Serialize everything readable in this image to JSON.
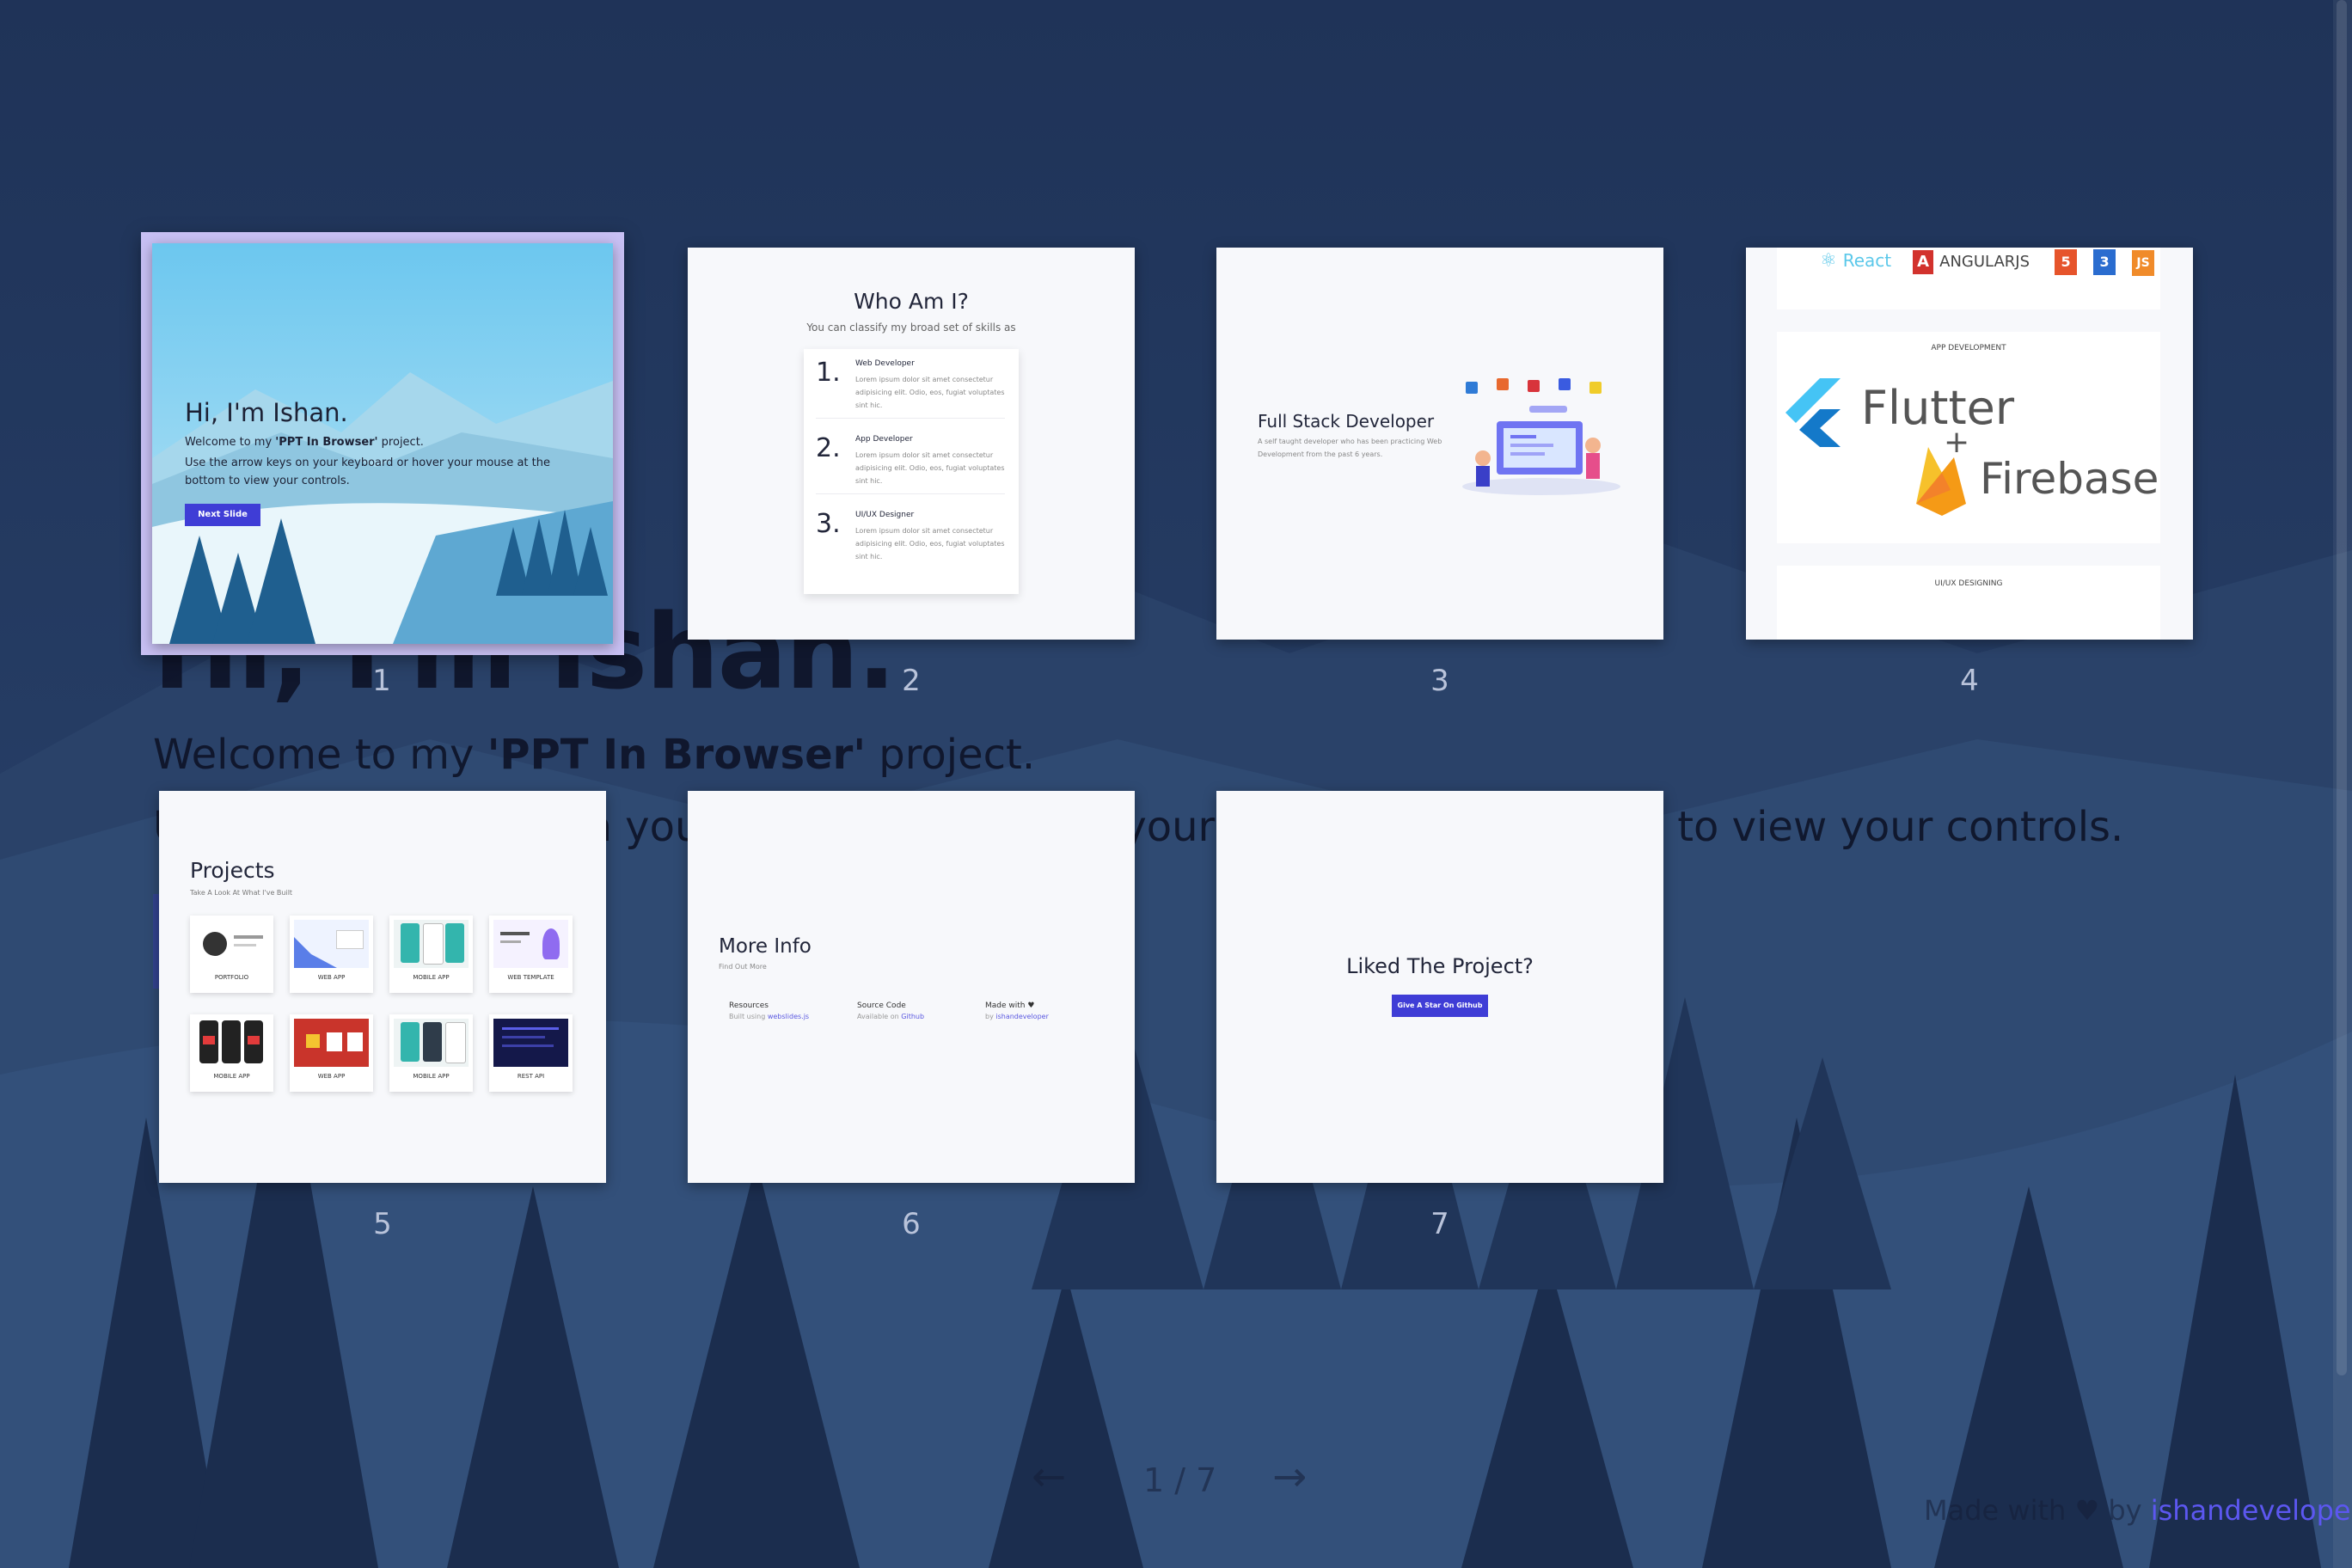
{
  "slides": [
    {
      "number": "1",
      "title": "Hi, I'm Ishan.",
      "welcome_prefix": "Welcome to my ",
      "project_name": "'PPT In Browser'",
      "welcome_suffix": " project.",
      "instructions": "Use the arrow keys on your keyboard or hover your mouse at the bottom to view your controls.",
      "button": "Next Slide"
    },
    {
      "number": "2",
      "title": "Who Am I?",
      "subtitle": "You can classify my broad set of skills as",
      "items": [
        {
          "num": "1.",
          "heading": "Web Developer",
          "text": "Lorem ipsum dolor sit amet consectetur adipisicing elit. Odio, eos, fugiat voluptates sint hic."
        },
        {
          "num": "2.",
          "heading": "App Developer",
          "text": "Lorem ipsum dolor sit amet consectetur adipisicing elit. Odio, eos, fugiat voluptates sint hic."
        },
        {
          "num": "3.",
          "heading": "UI/UX Designer",
          "text": "Lorem ipsum dolor sit amet consectetur adipisicing elit. Odio, eos, fugiat voluptates sint hic."
        }
      ]
    },
    {
      "number": "3",
      "title": "Full Stack Developer",
      "description": "A self taught developer who has been practicing Web Development from the past 6 years."
    },
    {
      "number": "4",
      "logos": [
        "React",
        "ANGULARJS",
        "5",
        "3",
        "JS"
      ],
      "app_label": "APP DEVELOPMENT",
      "flutter": "Flutter",
      "plus": "+",
      "firebase": "Firebase",
      "uiux_label": "UI/UX DESIGNING"
    },
    {
      "number": "5",
      "title": "Projects",
      "subtitle": "Take A Look At What I've Built",
      "tiles": [
        "PORTFOLIO",
        "WEB APP",
        "MOBILE APP",
        "WEB TEMPLATE",
        "MOBILE APP",
        "WEB APP",
        "MOBILE APP",
        "REST API"
      ]
    },
    {
      "number": "6",
      "title": "More Info",
      "subtitle": "Find Out More",
      "columns": [
        {
          "heading": "Resources",
          "text": "Built using ",
          "link": "webslides.js"
        },
        {
          "heading": "Source Code",
          "text": "Available on ",
          "link": "Github"
        },
        {
          "heading": "Made with ♥",
          "text": "by ",
          "link": "ishandeveloper"
        }
      ]
    },
    {
      "number": "7",
      "title": "Liked The Project?",
      "button": "Give A Star On Github"
    }
  ],
  "background_slide": {
    "title": "Hi, I'm Ishan.",
    "welcome_prefix": "Welcome to my ",
    "project_name": "'PPT In Browser'",
    "welcome_suffix": " project.",
    "instructions": "Use the arrow keys on your keyboard or hover your mouse at the bottom to view your controls."
  },
  "controls": {
    "prev_arrow": "←",
    "next_arrow": "→",
    "counter": "1 / 7"
  },
  "footer": {
    "made_with": "Made with ♥ by ",
    "author": "ishandeveloper"
  },
  "colors": {
    "accent": "#3f3dd6",
    "background": "#24395f",
    "active_frame": "#c8c0f4"
  }
}
